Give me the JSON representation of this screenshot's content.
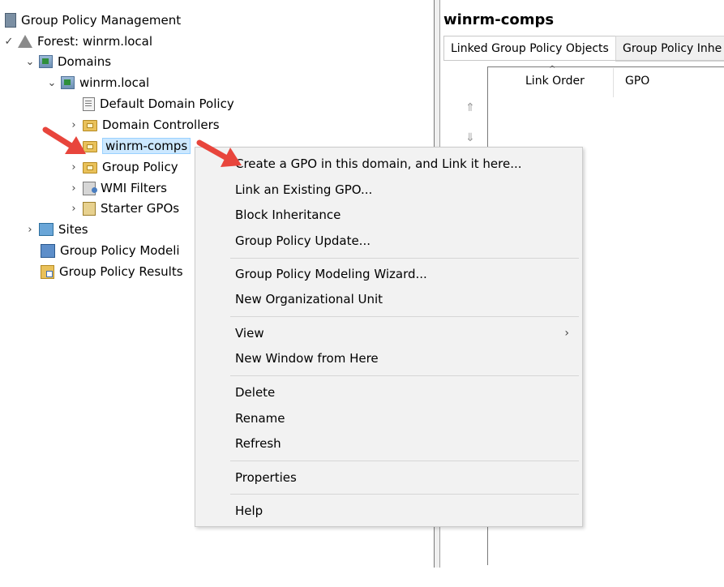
{
  "tree": {
    "root": "Group Policy Management",
    "forest": "Forest: winrm.local",
    "domains": "Domains",
    "domain": "winrm.local",
    "items": [
      "Default Domain Policy",
      "Domain Controllers",
      "winrm-comps",
      "Group Policy",
      "WMI Filters",
      "Starter GPOs"
    ],
    "sites": "Sites",
    "modeling": "Group Policy Modeli",
    "results": "Group Policy Results"
  },
  "right_pane": {
    "title": "winrm-comps",
    "tabs": [
      "Linked Group Policy Objects",
      "Group Policy Inhe"
    ],
    "columns": [
      "Link Order",
      "GPO"
    ]
  },
  "context_menu": {
    "items": [
      "Create a GPO in this domain, and Link it here...",
      "Link an Existing GPO...",
      "Block Inheritance",
      "Group Policy Update...",
      "Group Policy Modeling Wizard...",
      "New Organizational Unit",
      "View",
      "New Window from Here",
      "Delete",
      "Rename",
      "Refresh",
      "Properties",
      "Help"
    ]
  },
  "colors": {
    "arrow": "#e8453c",
    "menu_bg": "#f2f2f2",
    "selection": "#cce8ff"
  }
}
